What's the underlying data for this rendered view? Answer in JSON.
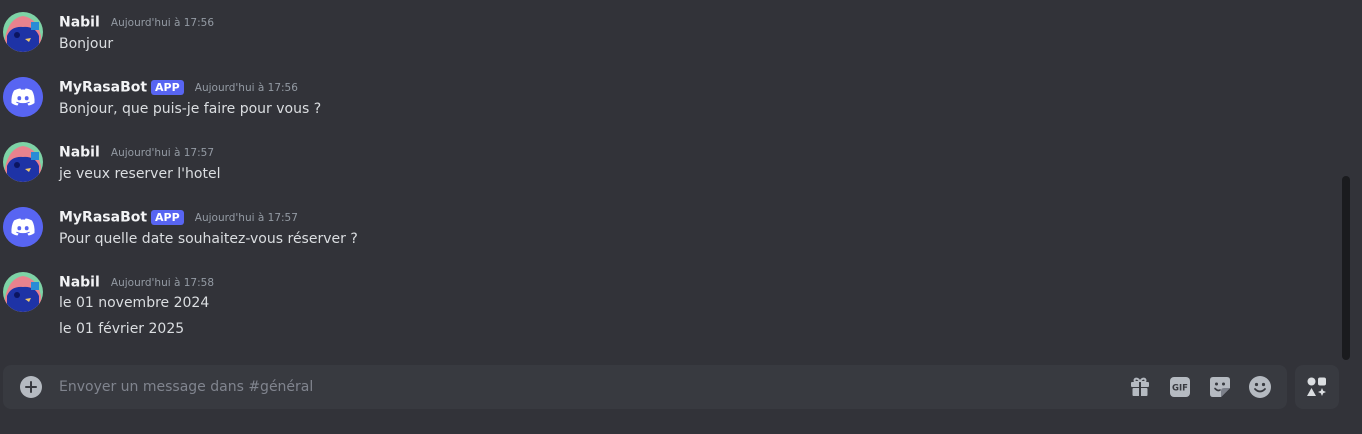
{
  "messages": [
    {
      "author": "Nabil",
      "is_bot": false,
      "timestamp": "Aujourd'hui à 17:56",
      "lines": [
        "Bonjour"
      ]
    },
    {
      "author": "MyRasaBot",
      "is_bot": true,
      "tag": "APP",
      "timestamp": "Aujourd'hui à 17:56",
      "lines": [
        "Bonjour, que puis-je faire pour vous ?"
      ]
    },
    {
      "author": "Nabil",
      "is_bot": false,
      "timestamp": "Aujourd'hui à 17:57",
      "lines": [
        "je veux reserver l'hotel"
      ]
    },
    {
      "author": "MyRasaBot",
      "is_bot": true,
      "tag": "APP",
      "timestamp": "Aujourd'hui à 17:57",
      "lines": [
        "Pour quelle date souhaitez-vous réserver ?"
      ]
    },
    {
      "author": "Nabil",
      "is_bot": false,
      "timestamp": "Aujourd'hui à 17:58",
      "lines": [
        "le 01 novembre 2024",
        "le 01 février 2025"
      ]
    }
  ],
  "composer": {
    "placeholder": "Envoyer un message dans #général",
    "gif_label": "GIF",
    "icons": [
      "plus-circle-icon",
      "gift-icon",
      "gif-icon",
      "sticker-icon",
      "emoji-icon",
      "apps-icon"
    ]
  },
  "colors": {
    "background": "#323339",
    "composer": "#383a40",
    "blurple": "#5865f2",
    "text": "#dbdee1",
    "muted": "#949ba4"
  }
}
